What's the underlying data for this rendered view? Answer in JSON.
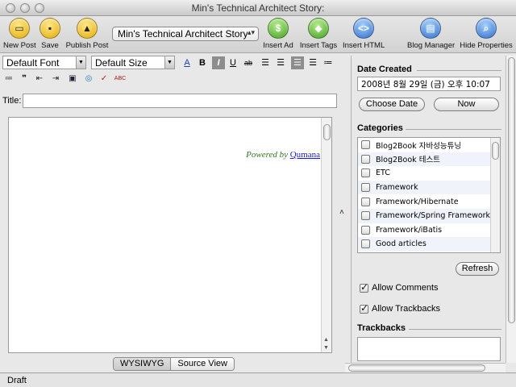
{
  "window": {
    "title": "Min's Technical Architect Story:"
  },
  "toolbar": {
    "new_post": "New Post",
    "save": "Save",
    "publish_post": "Publish Post",
    "blog_selected": "Min's Technical Architect Story",
    "insert_ad": "Insert Ad",
    "insert_tags": "Insert Tags",
    "insert_html": "Insert HTML",
    "blog_manager": "Blog Manager",
    "hide_properties": "Hide Properties"
  },
  "format": {
    "font": "Default Font",
    "size": "Default Size",
    "bold": "B",
    "italic": "I",
    "underline": "U",
    "strike": "ab"
  },
  "post": {
    "title_label": "Title:",
    "title_value": ""
  },
  "editor": {
    "powered_by": "Powered by",
    "powered_link": "Qumana",
    "wysiwyg_tab": "WYSIWYG",
    "source_tab": "Source View"
  },
  "status": {
    "text": "Draft"
  },
  "properties": {
    "date_created_label": "Date Created",
    "date_created_value": "2008년 8월 29일 (금) 오후 10:07",
    "choose_date": "Choose Date",
    "now": "Now",
    "categories_label": "Categories",
    "categories": [
      {
        "label": "Blog2Book 자바성능튜닝",
        "checked": false
      },
      {
        "label": "Blog2Book 테스트",
        "checked": false
      },
      {
        "label": "ETC",
        "checked": false
      },
      {
        "label": "Framework",
        "checked": false
      },
      {
        "label": "Framework/Hibernate",
        "checked": false
      },
      {
        "label": "Framework/Spring Framework",
        "checked": false
      },
      {
        "label": "Framework/iBatis",
        "checked": false
      },
      {
        "label": "Good articles",
        "checked": false
      }
    ],
    "refresh": "Refresh",
    "allow_comments": "Allow Comments",
    "allow_comments_checked": true,
    "allow_trackbacks": "Allow Trackbacks",
    "allow_trackbacks_checked": true,
    "trackbacks_label": "Trackbacks"
  }
}
